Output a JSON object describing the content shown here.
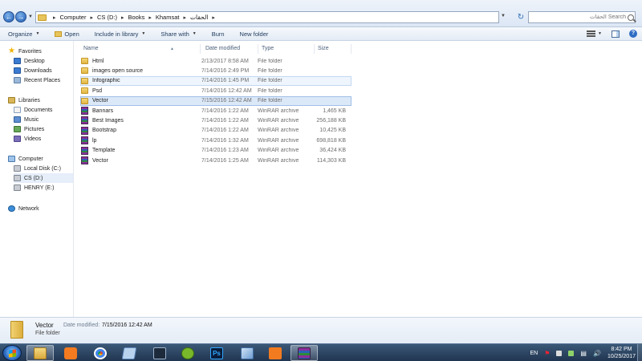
{
  "address_bar": {
    "crumbs": [
      "Computer",
      "CS (D:)",
      "Books",
      "Khamsat",
      "الحقات"
    ],
    "search_placeholder": "Search الحقات"
  },
  "toolbar": {
    "organize_label": "Organize",
    "open_label": "Open",
    "include_label": "Include in library",
    "share_label": "Share with",
    "burn_label": "Burn",
    "newfolder_label": "New folder"
  },
  "nav": {
    "favorites": "Favorites",
    "desktop": "Desktop",
    "downloads": "Downloads",
    "recent": "Recent Places",
    "libraries": "Libraries",
    "documents": "Documents",
    "music": "Music",
    "pictures": "Pictures",
    "videos": "Videos",
    "computer": "Computer",
    "local_disk": "Local Disk (C:)",
    "cs": "CS (D:)",
    "henry": "HENRY (E:)",
    "network": "Network"
  },
  "columns": {
    "name": "Name",
    "date": "Date modified",
    "type": "Type",
    "size": "Size"
  },
  "files": [
    {
      "name": "Html",
      "date": "2/13/2017 8:58 AM",
      "type": "File folder",
      "size": "",
      "kind": "folder"
    },
    {
      "name": "images open source",
      "date": "7/14/2016 2:49 PM",
      "type": "File folder",
      "size": "",
      "kind": "folder"
    },
    {
      "name": "Infographic",
      "date": "7/14/2016 1:45 PM",
      "type": "File folder",
      "size": "",
      "kind": "folder"
    },
    {
      "name": "Psd",
      "date": "7/14/2016 12:42 AM",
      "type": "File folder",
      "size": "",
      "kind": "folder"
    },
    {
      "name": "Vector",
      "date": "7/15/2016 12:42 AM",
      "type": "File folder",
      "size": "",
      "kind": "folder"
    },
    {
      "name": "Bannars",
      "date": "7/14/2016 1:22 AM",
      "type": "WinRAR archive",
      "size": "1,465 KB",
      "kind": "rar"
    },
    {
      "name": "Best Images",
      "date": "7/14/2016 1:22 AM",
      "type": "WinRAR archive",
      "size": "256,188 KB",
      "kind": "rar"
    },
    {
      "name": "Bootstrap",
      "date": "7/14/2016 1:22 AM",
      "type": "WinRAR archive",
      "size": "10,425 KB",
      "kind": "rar"
    },
    {
      "name": "lp",
      "date": "7/14/2016 1:32 AM",
      "type": "WinRAR archive",
      "size": "698,818 KB",
      "kind": "rar"
    },
    {
      "name": "Template",
      "date": "7/14/2016 1:23 AM",
      "type": "WinRAR archive",
      "size": "36,424 KB",
      "kind": "rar"
    },
    {
      "name": "Vector",
      "date": "7/14/2016 1:25 AM",
      "type": "WinRAR archive",
      "size": "114,303 KB",
      "kind": "rar"
    }
  ],
  "details": {
    "name": "Vector",
    "type": "File folder",
    "date_label": "Date modified:",
    "date": "7/15/2016 12:42 AM"
  },
  "taskbar": {
    "lang": "EN",
    "time": "8:42 PM",
    "date": "10/25/2017",
    "apps": [
      "file-explorer",
      "media-player",
      "chrome",
      "notepad",
      "app-dark",
      "utorrent",
      "photoshop",
      "virtualbox",
      "xampp",
      "winrar"
    ]
  }
}
